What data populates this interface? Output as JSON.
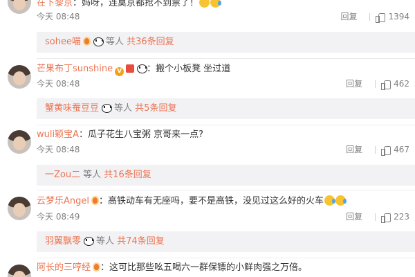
{
  "comments": [
    {
      "username": "在下黎京",
      "text": "妈呀，连莫京都抢不到票了！",
      "time": "今天 08:48",
      "reply_label": "回复",
      "likes": "1394",
      "sub_user": "sohee喵",
      "sub_others": "等人",
      "sub_count": "共36条回复"
    },
    {
      "username": "芒果布丁sunshine",
      "text": "搬个小板凳 坐过道",
      "time": "今天 08:48",
      "reply_label": "回复",
      "likes": "462",
      "sub_user": "蟹黄味蚕豆豆",
      "sub_others": "等人",
      "sub_count": "共5条回复"
    },
    {
      "username": "wuli颖宝A",
      "text": "瓜子花生八宝粥 京哥来一点?",
      "time": "今天 08:48",
      "reply_label": "回复",
      "likes": "467",
      "sub_user": "一Zou二",
      "sub_others": "等人",
      "sub_count": "共16条回复"
    },
    {
      "username": "云梦乐Angel",
      "text": "高铁动车有无座吗，要不是高铁，没见过这么好的火车",
      "time": "今天 08:49",
      "reply_label": "回复",
      "likes": "223",
      "sub_user": "羽翼飘零",
      "sub_others": "等人",
      "sub_count": "共74条回复"
    },
    {
      "username": "阿长的三哼经",
      "text": "这可比那些吆五喝六一群保镖的小鲜肉强之万倍。"
    }
  ]
}
